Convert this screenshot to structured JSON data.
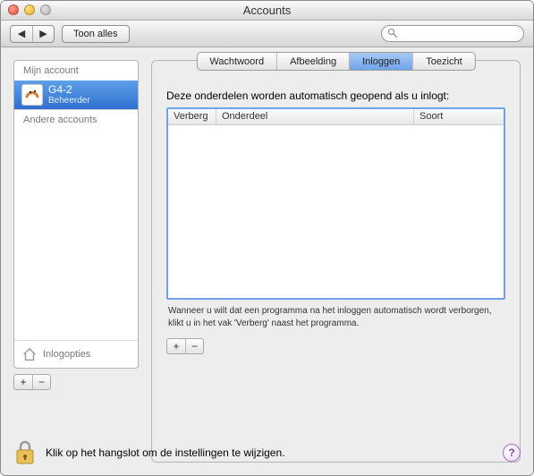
{
  "window": {
    "title": "Accounts"
  },
  "toolbar": {
    "show_all": "Toon alles",
    "search_placeholder": ""
  },
  "sidebar": {
    "groups": {
      "mine": "Mijn account",
      "others": "Andere accounts"
    },
    "account": {
      "name": "G4-2",
      "role": "Beheerder"
    },
    "login_options": "Inlogopties"
  },
  "pane": {
    "tabs": {
      "password": "Wachtwoord",
      "picture": "Afbeelding",
      "login": "Inloggen",
      "parental": "Toezicht"
    },
    "intro": "Deze onderdelen worden automatisch geopend als u inlogt:",
    "columns": {
      "hide": "Verberg",
      "item": "Onderdeel",
      "kind": "Soort"
    },
    "hint": "Wanneer u wilt dat een programma na het inloggen automatisch wordt verborgen, klikt u in het vak 'Verberg' naast het programma."
  },
  "footer": {
    "lock_msg": "Klik op het hangslot om de instellingen te wijzigen.",
    "help": "?"
  },
  "glyphs": {
    "plus": "+",
    "minus": "−",
    "back": "◀",
    "fwd": "▶",
    "search": "🔍"
  }
}
